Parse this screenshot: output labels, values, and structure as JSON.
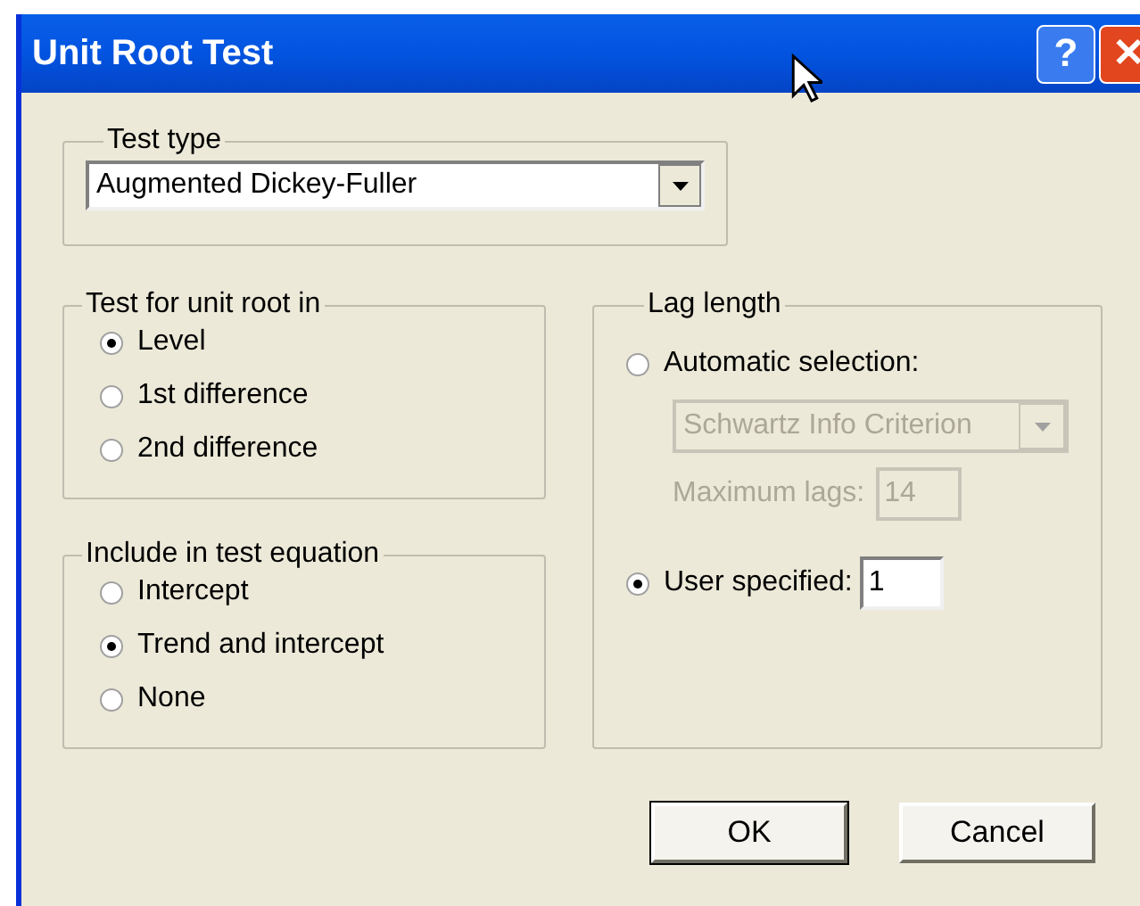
{
  "window": {
    "title": "Unit Root Test",
    "help_button": "?",
    "close_button": "✕"
  },
  "test_type": {
    "legend": "Test type",
    "value": "Augmented Dickey-Fuller"
  },
  "test_for_unit_root_in": {
    "legend": "Test for unit root in",
    "options": [
      {
        "label": "Level",
        "selected": true
      },
      {
        "label": "1st difference",
        "selected": false
      },
      {
        "label": "2nd difference",
        "selected": false
      }
    ]
  },
  "include_in_test_equation": {
    "legend": "Include in test equation",
    "options": [
      {
        "label": "Intercept",
        "selected": false
      },
      {
        "label": "Trend and intercept",
        "selected": true
      },
      {
        "label": "None",
        "selected": false
      }
    ]
  },
  "lag_length": {
    "legend": "Lag length",
    "automatic_selection": {
      "label": "Automatic selection:",
      "selected": false,
      "criterion": {
        "value": "Schwartz Info Criterion",
        "disabled": true
      },
      "maximum_lags": {
        "label": "Maximum lags:",
        "value": "14",
        "disabled": true
      }
    },
    "user_specified": {
      "label": "User specified:",
      "selected": true,
      "value": "1"
    }
  },
  "buttons": [
    {
      "label": "OK",
      "default": true
    },
    {
      "label": "Cancel",
      "default": false
    }
  ]
}
